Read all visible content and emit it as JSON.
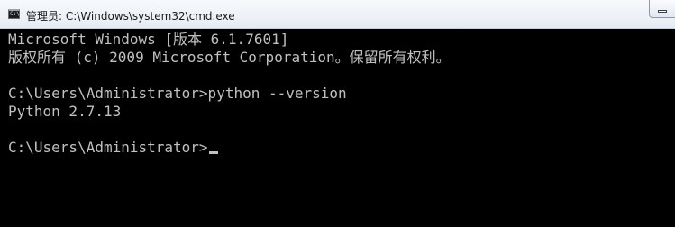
{
  "window": {
    "icon": "cmd-console-icon",
    "title": "管理员: C:\\Windows\\system32\\cmd.exe",
    "icon_glyph": "C:\\"
  },
  "console": {
    "lines": [
      "Microsoft Windows [版本 6.1.7601]",
      "版权所有 (c) 2009 Microsoft Corporation。保留所有权利。",
      "",
      "C:\\Users\\Administrator>python --version",
      "Python 2.7.13",
      "",
      "C:\\Users\\Administrator>"
    ],
    "text_color": "#c0c0c0",
    "background": "#000000"
  }
}
